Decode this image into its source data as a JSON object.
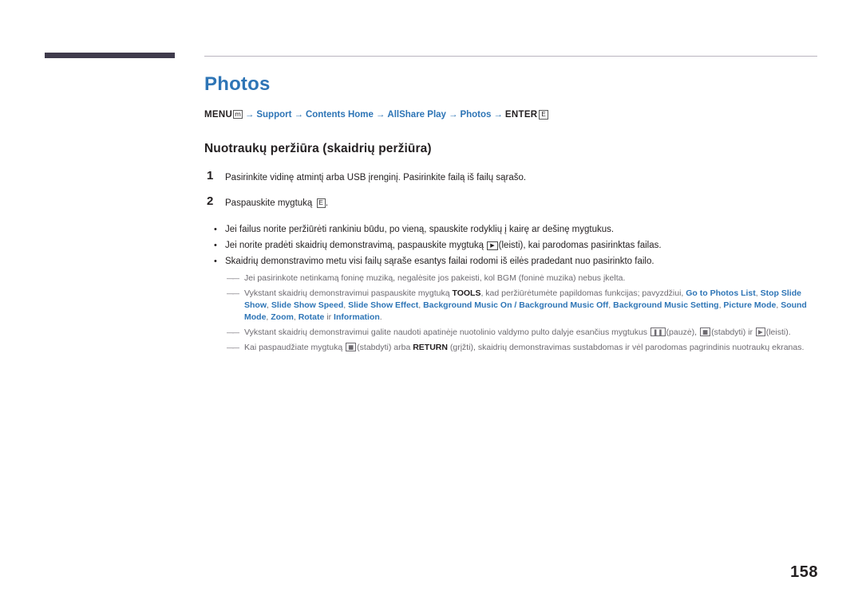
{
  "document": {
    "title": "Photos",
    "menu_path": {
      "menu_label": "MENU",
      "menu_icon": "m",
      "items": [
        "Support",
        "Contents Home",
        "AllShare Play",
        "Photos"
      ],
      "enter_label": "ENTER",
      "enter_icon": "E"
    },
    "subtitle": "Nuotraukų peržiūra (skaidrių peržiūra)",
    "steps": [
      {
        "num": "1",
        "text": "Pasirinkite vidinę atmintį arba USB įrenginį. Pasirinkite failą iš failų sąrašo."
      },
      {
        "num": "2",
        "text_before": "Paspauskite mygtuką ",
        "icon": "E",
        "text_after": "."
      }
    ],
    "bullets": [
      "Jei failus norite peržiūrėti rankiniu būdu, po vieną, spauskite rodyklių į kairę ar dešinę mygtukus.",
      {
        "before": "Jei norite pradėti skaidrių demonstravimą, paspauskite mygtuką ",
        "icon": "▶",
        "after": "(leisti), kai parodomas pasirinktas failas."
      },
      "Skaidrių demonstravimo metu visi failų sąraše esantys failai rodomi iš eilės pradedant nuo pasirinkto failo."
    ],
    "notes": [
      {
        "type": "plain",
        "text": "Jei pasirinkote netinkamą foninę muziką, negalėsite jos pakeisti, kol BGM (foninė muzika) nebus įkelta."
      },
      {
        "type": "tools",
        "pre": "Vykstant skaidrių demonstravimui paspauskite mygtuką ",
        "tools_label": "TOOLS",
        "mid": ", kad peržiūrėtumėte papildomas funkcijas; pavyzdžiui, ",
        "options": [
          "Go to Photos List",
          "Stop Slide Show",
          "Slide Show Speed",
          "Slide Show Effect",
          "Background Music On / Background Music Off",
          "Background Music Setting",
          "Picture Mode",
          "Sound Mode",
          "Zoom",
          "Rotate"
        ],
        "conj": "ir",
        "last_option": "Information",
        "end": "."
      },
      {
        "type": "buttons",
        "pre": "Vykstant skaidrių demonstravimui galite naudoti apatinėje nuotolinio valdymo pulto dalyje esančius mygtukus ",
        "btn1": "❚❚",
        "btn1_label": "(pauzė), ",
        "btn2": "■",
        "btn2_label": "(stabdyti) ir ",
        "btn3": "▶",
        "btn3_label": "(leisti)."
      },
      {
        "type": "return",
        "pre": "Kai paspaudžiate mygtuką ",
        "btn": "■",
        "mid": "(stabdyti) arba ",
        "return_label": "RETURN",
        "post": " (grįžti), skaidrių demonstravimas sustabdomas ir vėl parodomas pagrindinis nuotraukų ekranas."
      }
    ],
    "page_number": "158"
  }
}
